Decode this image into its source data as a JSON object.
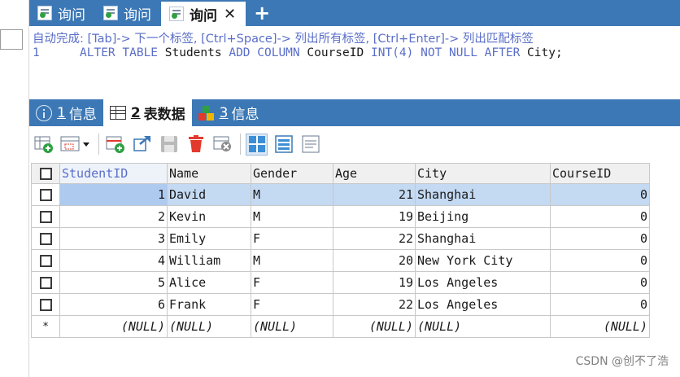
{
  "query_tabs": [
    {
      "label": "询问",
      "active": false
    },
    {
      "label": "询问",
      "active": false
    },
    {
      "label": "询问",
      "active": true
    }
  ],
  "new_tab_label": "+",
  "close_label": "✕",
  "editor": {
    "hint": "自动完成: [Tab]-> 下一个标签, [Ctrl+Space]-> 列出所有标签, [Ctrl+Enter]-> 列出匹配标签",
    "line_number": "1",
    "sql": {
      "kw1": "ALTER TABLE",
      "t1": "Students",
      "kw2": "ADD COLUMN",
      "t2": "CourseID",
      "kw3": "INT(4)",
      "kw4": "NOT NULL AFTER",
      "t3": "City;"
    }
  },
  "result_tabs": [
    {
      "num": "1",
      "label": "信息",
      "active": false
    },
    {
      "num": "2",
      "label": "表数据",
      "active": true
    },
    {
      "num": "3",
      "label": "信息",
      "active": false
    }
  ],
  "columns": [
    "StudentID",
    "Name",
    "Gender",
    "Age",
    "City",
    "CourseID"
  ],
  "rows": [
    [
      "1",
      "David",
      "M",
      "21",
      "Shanghai",
      "0"
    ],
    [
      "2",
      "Kevin",
      "M",
      "19",
      "Beijing",
      "0"
    ],
    [
      "3",
      "Emily",
      "F",
      "22",
      "Shanghai",
      "0"
    ],
    [
      "4",
      "William",
      "M",
      "20",
      "New York City",
      "0"
    ],
    [
      "5",
      "Alice",
      "F",
      "19",
      "Los Angeles",
      "0"
    ],
    [
      "6",
      "Frank",
      "F",
      "22",
      "Los Angeles",
      "0"
    ]
  ],
  "new_row_marker": "*",
  "null_text": "(NULL)",
  "watermark": "CSDN @创不了浩",
  "colors": {
    "accent": "#3c78b5",
    "keyword": "#5a6ec8",
    "selection": "#c4d9f2"
  },
  "icons": [
    "query-tab-icon",
    "info-icon",
    "table-icon",
    "blocks-icon",
    "insert-row-icon",
    "grid-dropdown-icon",
    "duplicate-row-icon",
    "refresh-icon",
    "save-icon",
    "delete-icon",
    "cancel-icon",
    "grid-view-icon",
    "form-view-icon",
    "text-view-icon"
  ]
}
